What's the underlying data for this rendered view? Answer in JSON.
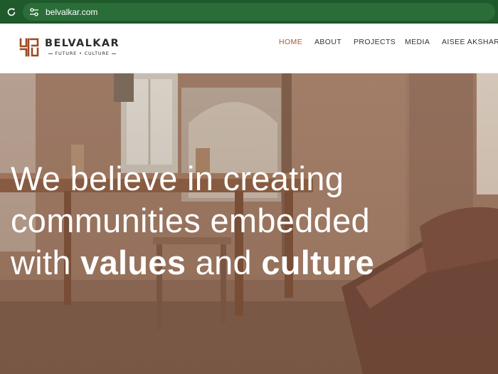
{
  "browser": {
    "url": "belvalkar.com",
    "icons": {
      "reload": "reload-icon",
      "site_info": "site-settings-icon"
    },
    "colors": {
      "bar": "#1e5a2c",
      "pill": "#2a6d38"
    }
  },
  "header": {
    "logo": {
      "name": "BELVALKAR",
      "tagline_left": "FUTURE",
      "tagline_sep": "•",
      "tagline_right": "CULTURE",
      "mark_icon": "belvalkar-emblem-icon",
      "mark_color": "#9c4a22"
    },
    "nav": [
      {
        "label": "HOME",
        "active": true
      },
      {
        "label": "ABOUT",
        "active": false
      },
      {
        "label": "PROJECTS",
        "active": false
      },
      {
        "label": "MEDIA",
        "active": false
      },
      {
        "label": "AISEE AKSHARE",
        "active": false
      }
    ],
    "colors": {
      "active_nav": "#a85a2a",
      "nav": "#333333"
    }
  },
  "hero": {
    "line1": "We believe in creating",
    "line2": "communities embedded",
    "line3_prefix": "with ",
    "line3_bold1": "values",
    "line3_mid": " and ",
    "line3_bold2": "culture",
    "background": "interior-photo"
  }
}
